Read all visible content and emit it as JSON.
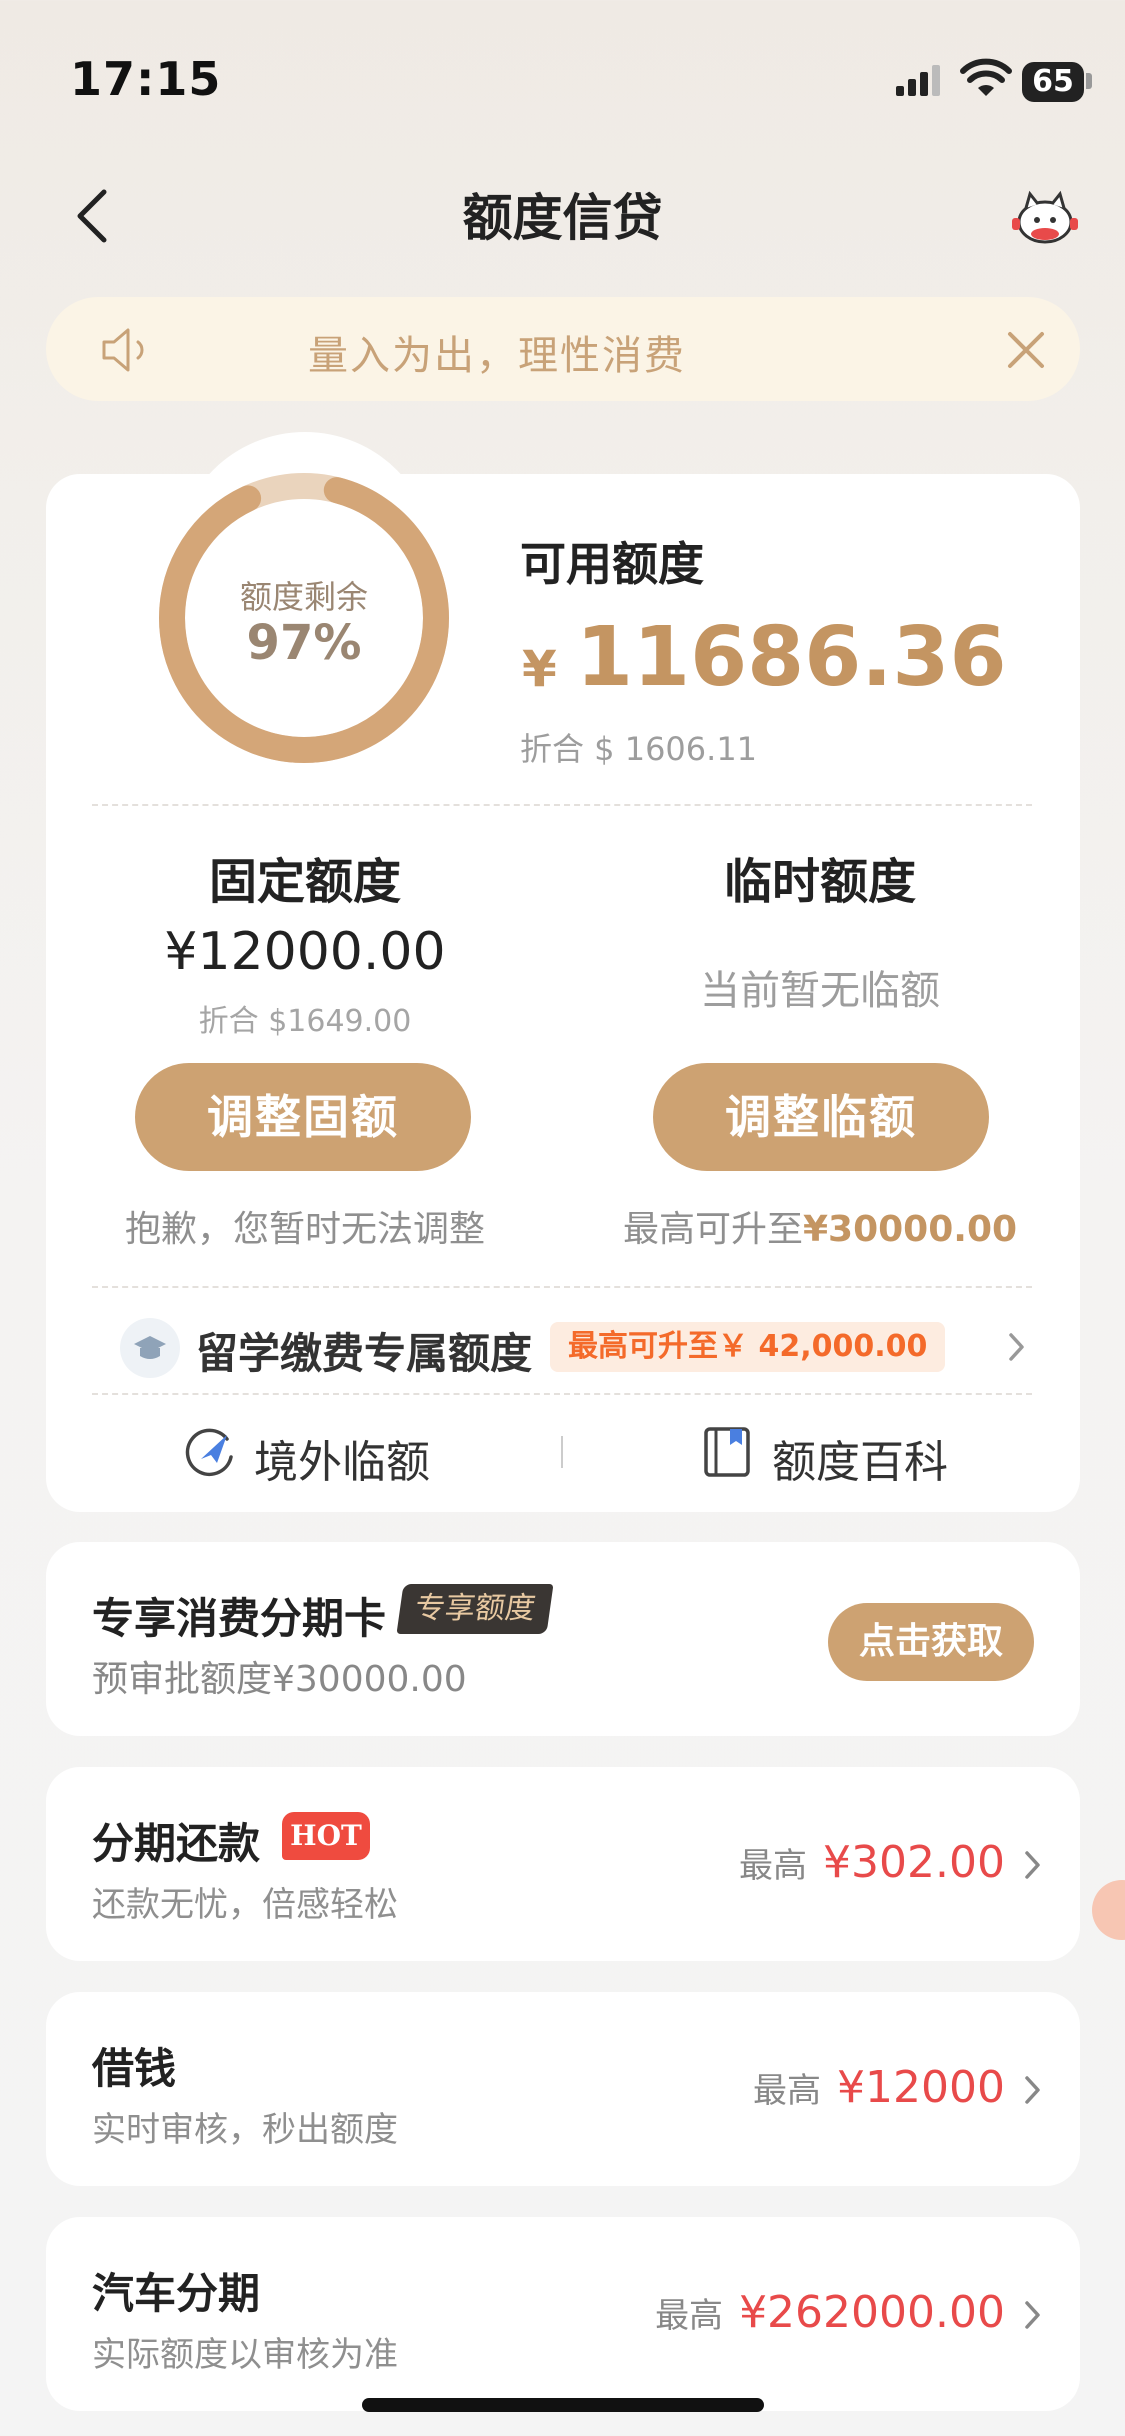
{
  "status_bar": {
    "time": "17:15",
    "battery": "65"
  },
  "nav": {
    "title": "额度信贷"
  },
  "notice": {
    "text": "量入为出，理性消费"
  },
  "quota": {
    "ring_label": "额度剩余",
    "ring_percent": "97%",
    "ring_fraction": 0.97,
    "available_label": "可用额度",
    "currency_symbol": "¥",
    "available_amount": "11686.36",
    "available_conversion": "折合 $ 1606.11",
    "fixed": {
      "title": "固定额度",
      "amount": "¥12000.00",
      "conversion": "折合 $1649.00",
      "button": "调整固额",
      "note": "抱歉，您暂时无法调整"
    },
    "temporary": {
      "title": "临时额度",
      "status": "当前暂无临额",
      "button": "调整临额",
      "note_prefix": "最高可升至",
      "note_amount": "¥30000.00"
    },
    "study_abroad": {
      "label": "留学缴费专属额度",
      "tag": "最高可升至￥ 42,000.00"
    },
    "links": {
      "overseas": "境外临额",
      "encyclopedia": "额度百科"
    }
  },
  "installment_card": {
    "title": "专享消费分期卡",
    "tag": "专享额度",
    "subtitle": "预审批额度¥30000.00",
    "button": "点击获取"
  },
  "services": [
    {
      "title": "分期还款",
      "badge": "HOT",
      "subtitle": "还款无忧，倍感轻松",
      "prefix": "最高",
      "amount": "¥302.00"
    },
    {
      "title": "借钱",
      "subtitle": "实时审核，秒出额度",
      "prefix": "最高",
      "amount": "¥12000"
    },
    {
      "title": "汽车分期",
      "subtitle": "实际额度以审核为准",
      "prefix": "最高",
      "amount": "¥262000.00"
    }
  ],
  "colors": {
    "accent": "#cda272",
    "gold_text": "#c49562",
    "red": "#e84a4a",
    "notice_bg": "#fbf4e6"
  }
}
